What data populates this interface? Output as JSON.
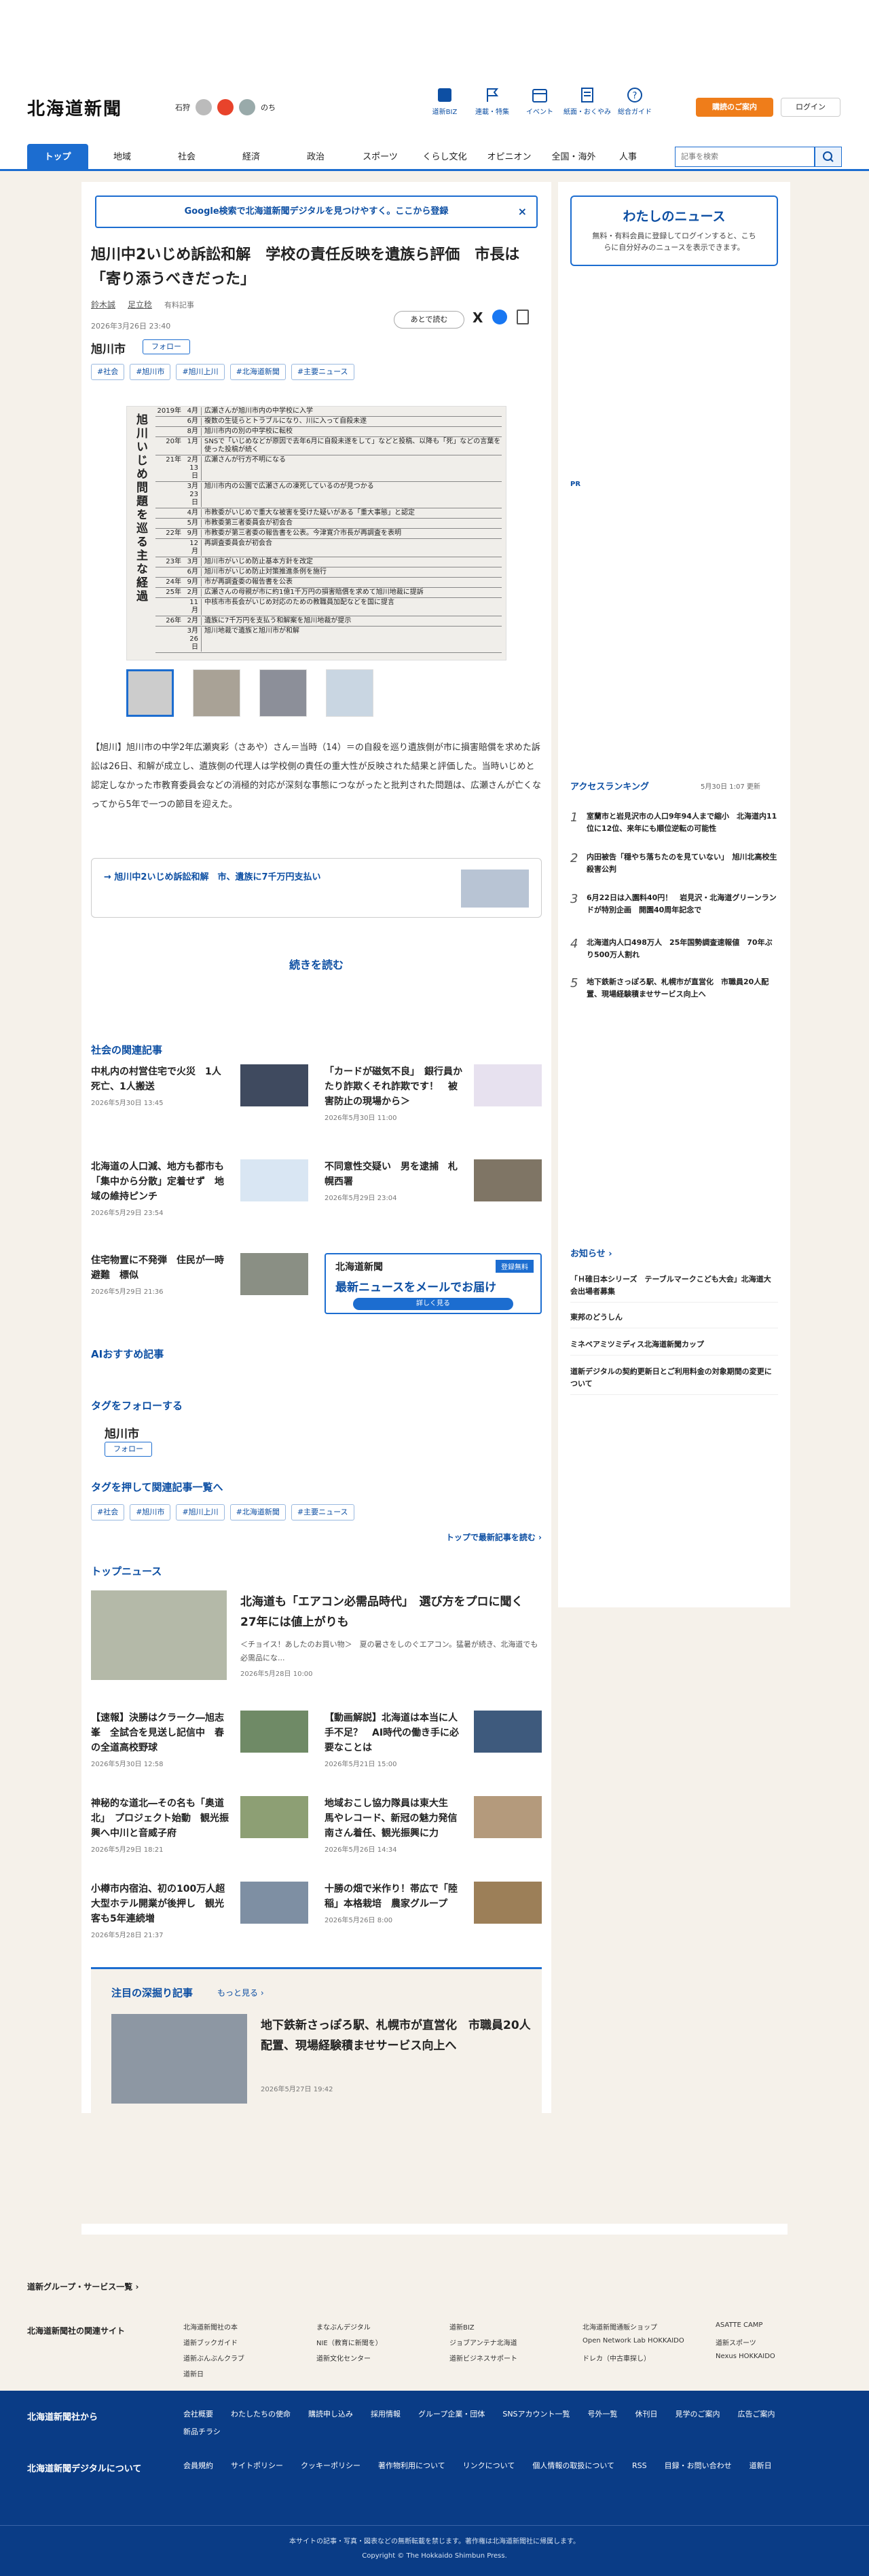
{
  "header": {
    "logo": "北海道新聞",
    "weather_area": "石狩",
    "weather_note": "のち",
    "nav": [
      {
        "label": "道新BIZ",
        "icon": "biz-icon"
      },
      {
        "label": "連載・特集",
        "icon": "flag-icon"
      },
      {
        "label": "イベント",
        "icon": "calendar-icon"
      },
      {
        "label": "紙面・おくやみ",
        "icon": "newspaper-icon"
      },
      {
        "label": "総合ガイド",
        "icon": "help-icon"
      }
    ],
    "subscribe": "購読のご案内",
    "login": "ログイン",
    "search_placeholder": "記事を検索",
    "colors": {
      "accent": "#1c6dd0",
      "brand_orange": "#ef7d1a",
      "footer": "#0a3c86"
    }
  },
  "global_nav": [
    "トップ",
    "地域",
    "社会",
    "経済",
    "政治",
    "スポーツ",
    "くらし文化",
    "オピニオン",
    "全国・海外",
    "人事"
  ],
  "google_banner": "Google検索で北海道新聞デジタルを見つけやすく。ここから登録",
  "article": {
    "headline": "旭川中2いじめ訴訟和解　学校の責任反映を遺族ら評価　市長は「寄り添うべきだった」",
    "authors": [
      "鈴木誠",
      "足立稔",
      "有料記事"
    ],
    "date": "2026年3月26日 23:40",
    "later": "あとで読む",
    "city": "旭川市",
    "follow": "フォロー",
    "tags": [
      "#社会",
      "#旭川市",
      "#旭川上川",
      "#北海道新聞",
      "#主要ニュース"
    ],
    "photo_title": "旭川いじめ問題を巡る主な経過",
    "timeline": [
      [
        "2019年",
        "4月",
        "広瀬さんが旭川市内の中学校に入学"
      ],
      [
        "",
        "6月",
        "複数の生徒らとトラブルになり、川に入って自殺未遂"
      ],
      [
        "",
        "8月",
        "旭川市内の別の中学校に転校"
      ],
      [
        "20年",
        "1月",
        "SNSで「いじめなどが原因で去年6月に自殺未遂をして」などと投稿、以降も「死」などの言葉を使った投稿が続く"
      ],
      [
        "21年",
        "2月13日",
        "広瀬さんが行方不明になる"
      ],
      [
        "",
        "3月23日",
        "旭川市内の公園で広瀬さんの凍死しているのが見つかる"
      ],
      [
        "",
        "4月",
        "市教委がいじめで重大な被害を受けた疑いがある「重大事態」と認定"
      ],
      [
        "",
        "5月",
        "市教委第三者委員会が初会合"
      ],
      [
        "22年",
        "9月",
        "市教委が第三者委の報告書を公表。今津寛介市長が再調査を表明"
      ],
      [
        "",
        "12月",
        "再調査委員会が初会合"
      ],
      [
        "23年",
        "3月",
        "旭川市がいじめ防止基本方針を改定"
      ],
      [
        "",
        "6月",
        "旭川市がいじめ防止対策推進条例を施行"
      ],
      [
        "24年",
        "9月",
        "市が再調査委の報告書を公表"
      ],
      [
        "25年",
        "2月",
        "広瀬さんの母親が市に約1億1千万円の損害賠償を求めて旭川地裁に提訴"
      ],
      [
        "",
        "11月",
        "中核市市長会がいじめ対応のための教職員加配などを国に提言"
      ],
      [
        "26年",
        "2月",
        "遺族に7千万円を支払う和解案を旭川地裁が提示"
      ],
      [
        "",
        "3月26日",
        "旭川地裁で遺族と旭川市が和解"
      ]
    ],
    "lead": "【旭川】旭川市の中学2年広瀬爽彩（さあや）さん＝当時（14）＝の自殺を巡り遺族側が市に損害賠償を求めた訴訟は26日、和解が成立し、遺族側の代理人は学校側の責任の重大性が反映された結果と評価した。当時いじめと認定しなかった市教育委員会などの消極的対応が深刻な事態につながったと批判された問題は、広瀬さんが亡くなってから5年で一つの節目を迎えた。",
    "related_link": "旭川中2いじめ訴訟和解　市、遺族に7千万円支払い",
    "read_more": "続きを読む"
  },
  "social_related": {
    "title": "社会の関連記事",
    "items": [
      {
        "title": "中札内の村営住宅で火災　1人死亡、1人搬送",
        "date": "2026年5月30日 13:45"
      },
      {
        "title": "「カードが磁気不良」　銀行員かたり詐欺くそれ詐欺です！　被害防止の現場から＞",
        "date": "2026年5月30日 11:00"
      },
      {
        "title": "北海道の人口減、地方も都市も「集中から分散」定着せず　地域の維持ピンチ",
        "date": "2026年5月29日 23:54"
      },
      {
        "title": "不同意性交疑い　男を逮捕　札幌西署",
        "date": "2026年5月29日 23:04"
      },
      {
        "title": "住宅物置に不発弾　住民が一時避難　標似",
        "date": "2026年5月29日 21:36"
      }
    ]
  },
  "mail_banner": {
    "brand": "北海道新聞",
    "badge": "登録無料",
    "title": "最新ニュースをメールでお届け",
    "cta": "詳しく見る"
  },
  "ai_title": "AIおすすめ記事",
  "follow_tags": {
    "title": "タグをフォローする",
    "city": "旭川市",
    "follow": "フォロー"
  },
  "tag_list_title": "タグを押して関連記事一覧へ",
  "to_top": "トップで最新記事を読む",
  "top_news": {
    "title": "トップニュース",
    "feature": {
      "title": "北海道も「エアコン必需品時代」　選び方をプロに聞く　27年には値上がりも",
      "summary": "＜チョイス！あしたのお買い物＞　夏の暑さをしのぐエアコン。猛暑が続き、北海道でも必需品にな...",
      "date": "2026年5月28日 10:00"
    },
    "items": [
      {
        "title": "【速報】決勝はクラーク―旭志峯　全試合を見送し記信中　春の全道高校野球",
        "date": "2026年5月30日 12:58"
      },
      {
        "title": "【動画解説】北海道は本当に人手不足？　AI時代の働き手に必要なことは",
        "date": "2026年5月21日 15:00"
      },
      {
        "title": "神秘的な道北―その名も「奥道北」　プロジェクト始動　観光振興へ中川と音威子府",
        "date": "2026年5月29日 18:21"
      },
      {
        "title": "地域おこし協力隊員は東大生　馬やレコード、新冠の魅力発信　南さん着任、観光振興に力",
        "date": "2026年5月26日 14:34"
      },
      {
        "title": "小樽市内宿泊、初の100万人超　大型ホテル開業が後押し　観光客も5年連続増",
        "date": "2026年5月28日 21:37"
      },
      {
        "title": "十勝の畑で米作り！帯広で「陸稲」本格栽培　農家グループ",
        "date": "2026年5月26日 8:00"
      }
    ]
  },
  "deep": {
    "title": "注目の深掘り記事",
    "more": "もっと見る",
    "item_title": "地下鉄新さっぽろ駅、札幌市が直営化　市職員20人配置、現場経験積ませサービス向上へ",
    "item_date": "2026年5月27日 19:42"
  },
  "sidebar": {
    "mynews_title": "わたしのニュース",
    "mynews_text": "無料・有料会員に登録してログインすると、こちらに自分好みのニュースを表示できます。",
    "pr": "PR",
    "ranking_title": "アクセスランキング",
    "ranking_date": "5月30日 1:07 更新",
    "ranking": [
      "室蘭市と岩見沢市の人口9年94人まで縮小　北海道内11位に12位、来年にも順位逆転の可能性",
      "内田被告「穏やち落ちたのを見ていない」　旭川北高校生殺害公判",
      "6月22日は入園料40円！　岩見沢・北海道グリーンランドが特別企画　開園40周年記念で",
      "北海道内人口498万人　25年国勢調査速報値　70年ぶり500万人割れ",
      "地下鉄新さっぽろ駅、札幌市が直営化　市職員20人配置、現場経験積ませサービス向上へ"
    ],
    "notice_title": "お知らせ",
    "notices": [
      "「Ｈ碓日本シリーズ　テーブルマークこども大会」北海道大会出場者募集",
      "東邦のどうしん",
      "ミネベアミツミディス北海道新聞カップ",
      "道新デジタルの契約更新日とご利用料金の対象期間の変更について"
    ]
  },
  "footer": {
    "group_services": "道新グループ・サービス一覧",
    "related_sites_title": "北海道新聞社の関連サイト",
    "related_sites": [
      "北海道新聞社の本",
      "まなぶんデジタル",
      "道新BIZ",
      "北海道新聞通販ショップ",
      "ASATTE CAMP",
      "道新ブックガイド",
      "NIE（教育に新聞を）",
      "ジョブアンテナ北海道",
      "Open Network Lab HOKKAIDO",
      "道新スポーツ",
      "道新ぶんぶんクラブ",
      "道新文化センター",
      "道新ビジネスサポート",
      "ドレカ（中古車探し）",
      "Nexus HOKKAIDO",
      "道新日"
    ],
    "company_title": "北海道新聞社から",
    "company_links": [
      "会社概要",
      "わたしたちの使命",
      "購読申し込み",
      "採用情報",
      "グループ企業・団体",
      "SNSアカウント一覧",
      "号外一覧",
      "休刊日",
      "見学のご案内",
      "広告ご案内",
      "新品チラシ"
    ],
    "digital_title": "北海道新聞デジタルについて",
    "digital_links": [
      "会員規約",
      "サイトポリシー",
      "クッキーポリシー",
      "著作物利用について",
      "リンクについて",
      "個人情報の取扱について",
      "RSS",
      "目録・お問い合わせ",
      "道新日"
    ],
    "note": "本サイトの記事・写真・図表などの無断転載を禁じます。著作権は北海道新聞社に帰属します。",
    "copyright": "Copyright © The Hokkaido Shimbun Press."
  }
}
